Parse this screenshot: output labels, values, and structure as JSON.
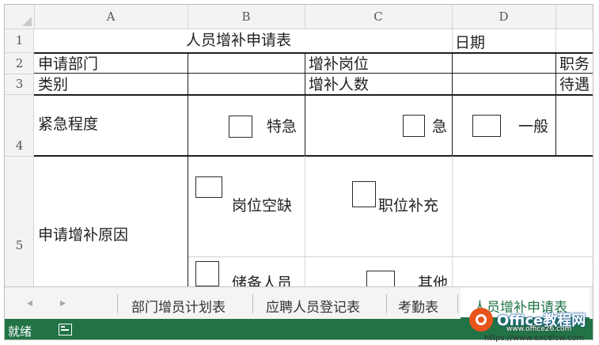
{
  "columns": [
    "A",
    "B",
    "C",
    "D"
  ],
  "rows": [
    "1",
    "2",
    "3",
    "4",
    "5"
  ],
  "cells": {
    "title": "人员增补申请表",
    "date_label": "日期",
    "dept_label": "申请部门",
    "position_label": "增补岗位",
    "duty_label": "职务",
    "category_label": "类别",
    "headcount_label": "增补人数",
    "treatment_label": "待遇",
    "urgency_label": "紧急程度",
    "urgency_options": [
      "特急",
      "急",
      "一般"
    ],
    "reason_label": "申请增补原因",
    "reason_options": [
      "岗位空缺",
      "职位补充",
      "储备人员",
      "其他"
    ]
  },
  "sheet_tabs": {
    "nav_prev": "◂",
    "nav_next": "▸",
    "tabs": [
      "部门增员计划表",
      "应聘人员登记表",
      "考勤表",
      "人员增补申请表"
    ],
    "active_index": 3
  },
  "status_bar": {
    "ready_text": "就绪"
  },
  "watermark": {
    "brand": "Office教程网",
    "url1": "www.office26.com",
    "url2": "https://www.excelcw.com"
  }
}
